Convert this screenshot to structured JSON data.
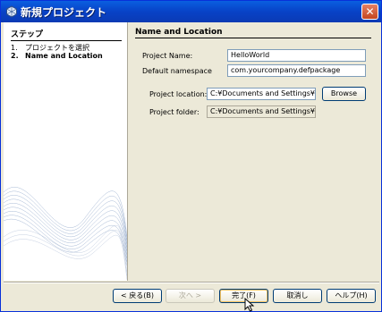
{
  "window": {
    "title": "新規プロジェクト"
  },
  "steps": {
    "heading": "ステップ",
    "items": [
      {
        "num": "1.",
        "label": "プロジェクトを選択"
      },
      {
        "num": "2.",
        "label": "Name and Location"
      }
    ]
  },
  "form": {
    "heading": "Name and Location",
    "project_name_label": "Project Name:",
    "project_name_value": "HelloWorld",
    "namespace_label": "Default namespace",
    "namespace_value": "com.yourcompany.defpackage",
    "location_label": "Project location:",
    "location_value": "C:¥Documents and Settings¥naot",
    "browse_label": "Browse",
    "folder_label": "Project folder:",
    "folder_value": "C:¥Documents and Settings¥naot"
  },
  "buttons": {
    "back": "< 戻る(B)",
    "next": "次へ >",
    "finish": "完了(F)",
    "cancel": "取消し",
    "help": "ヘルプ(H)"
  },
  "icons": {
    "app": "netbeans-icon",
    "close": "close-icon",
    "cursor": "mouse-cursor-icon"
  }
}
